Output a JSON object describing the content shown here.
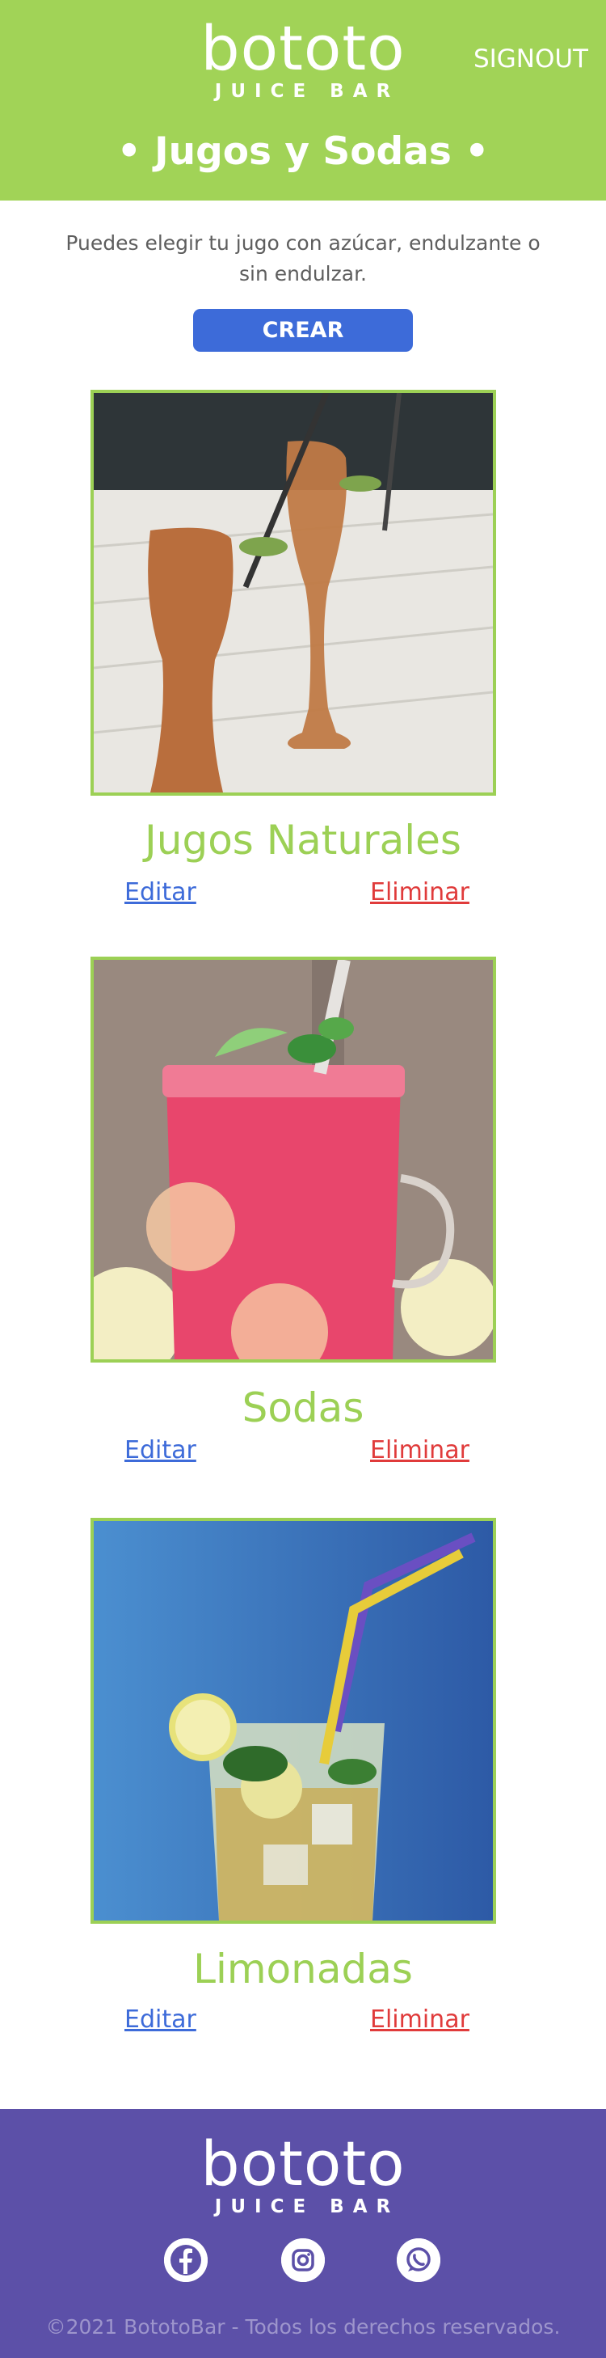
{
  "header": {
    "logo_main": "bototo",
    "logo_sub": "JUICE BAR",
    "signout_label": "SIGNOUT",
    "page_title": "• Jugos y Sodas •"
  },
  "intro": {
    "text": "Puedes elegir tu jugo con azúcar, endulzante o sin endulzar.",
    "create_label": "CREAR"
  },
  "cards": [
    {
      "title": "Jugos Naturales",
      "edit_label": "Editar",
      "delete_label": "Eliminar"
    },
    {
      "title": "Sodas",
      "edit_label": "Editar",
      "delete_label": "Eliminar"
    },
    {
      "title": "Limonadas",
      "edit_label": "Editar",
      "delete_label": "Eliminar"
    }
  ],
  "footer": {
    "logo_main": "bototo",
    "logo_sub": "JUICE BAR",
    "social": [
      "facebook-icon",
      "instagram-icon",
      "whatsapp-icon"
    ],
    "copyright": "©2021 BototoBar - Todos los derechos reservados."
  },
  "colors": {
    "header_green": "#a1d357",
    "accent_green": "#9cd055",
    "button_blue": "#3d6bd9",
    "delete_red": "#e03b3b",
    "footer_purple": "#5c50a8"
  }
}
